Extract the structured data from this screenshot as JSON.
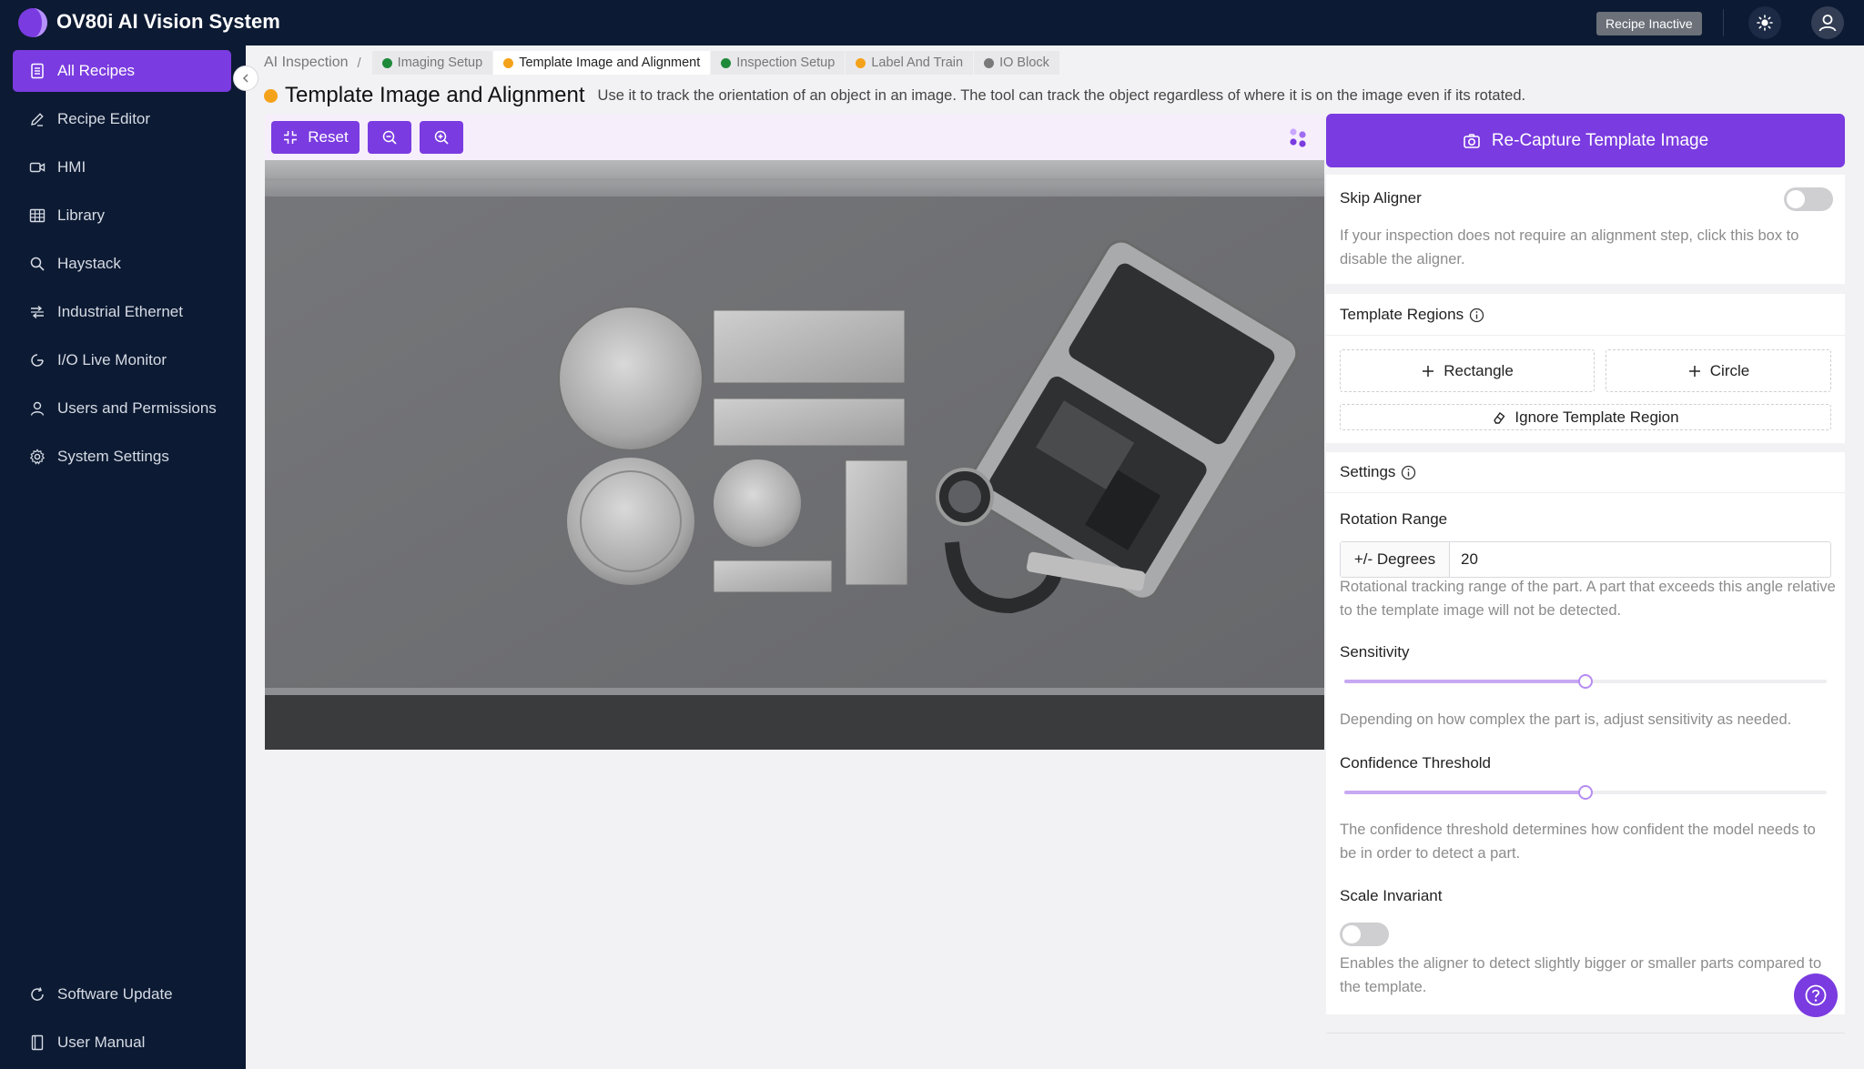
{
  "app": {
    "title": "OV80i AI Vision System",
    "status": "Recipe Inactive",
    "accent": "#7a3be0"
  },
  "sidebar": {
    "items": [
      {
        "label": "All Recipes",
        "icon": "document-icon",
        "active": true
      },
      {
        "label": "Recipe Editor",
        "icon": "pencil-icon"
      },
      {
        "label": "HMI",
        "icon": "video-icon"
      },
      {
        "label": "Library",
        "icon": "grid-icon"
      },
      {
        "label": "Haystack",
        "icon": "search-icon"
      },
      {
        "label": "Industrial Ethernet",
        "icon": "network-icon"
      },
      {
        "label": "I/O Live Monitor",
        "icon": "gauge-icon"
      },
      {
        "label": "Users and Permissions",
        "icon": "user-icon"
      },
      {
        "label": "System Settings",
        "icon": "gear-icon"
      }
    ],
    "footer": [
      {
        "label": "Software Update",
        "icon": "refresh-icon"
      },
      {
        "label": "User Manual",
        "icon": "book-icon"
      }
    ]
  },
  "breadcrumb": {
    "root": "AI Inspection",
    "separator": "/",
    "steps": [
      {
        "label": "Imaging Setup",
        "color": "#1f8a3a"
      },
      {
        "label": "Template Image and Alignment",
        "color": "#f5a21b",
        "current": true
      },
      {
        "label": "Inspection Setup",
        "color": "#1f8a3a"
      },
      {
        "label": "Label And Train",
        "color": "#f5a21b"
      },
      {
        "label": "IO Block",
        "color": "#7a7a7a"
      }
    ]
  },
  "page": {
    "title": "Template Image and Alignment",
    "description": "Use it to track the orientation of an object in an image. The tool can track the object regardless of where it is on the image even if its rotated."
  },
  "toolbar": {
    "reset_label": "Reset"
  },
  "right": {
    "recapture_label": "Re-Capture Template Image",
    "skip_aligner": {
      "label": "Skip Aligner",
      "help": "If your inspection does not require an alignment step, click this box to disable the aligner.",
      "enabled": false
    },
    "template_regions": {
      "title": "Template Regions",
      "rectangle_label": "Rectangle",
      "circle_label": "Circle",
      "ignore_label": "Ignore Template Region"
    },
    "settings": {
      "title": "Settings",
      "rotation_label": "Rotation Range",
      "rotation_addon": "+/- Degrees",
      "rotation_value": "20",
      "rotation_help": "Rotational tracking range of the part. A part that exceeds this angle relative to the template image will not be detected.",
      "sensitivity_label": "Sensitivity",
      "sensitivity_value": 0.5,
      "sensitivity_help": "Depending on how complex the part is, adjust sensitivity as needed.",
      "confidence_label": "Confidence Threshold",
      "confidence_value": 0.5,
      "confidence_help": "The confidence threshold determines how confident the model needs to be in order to detect a part.",
      "scale_label": "Scale Invariant",
      "scale_help": "Enables the aligner to detect slightly bigger or smaller parts compared to the template.",
      "scale_enabled": false
    }
  }
}
